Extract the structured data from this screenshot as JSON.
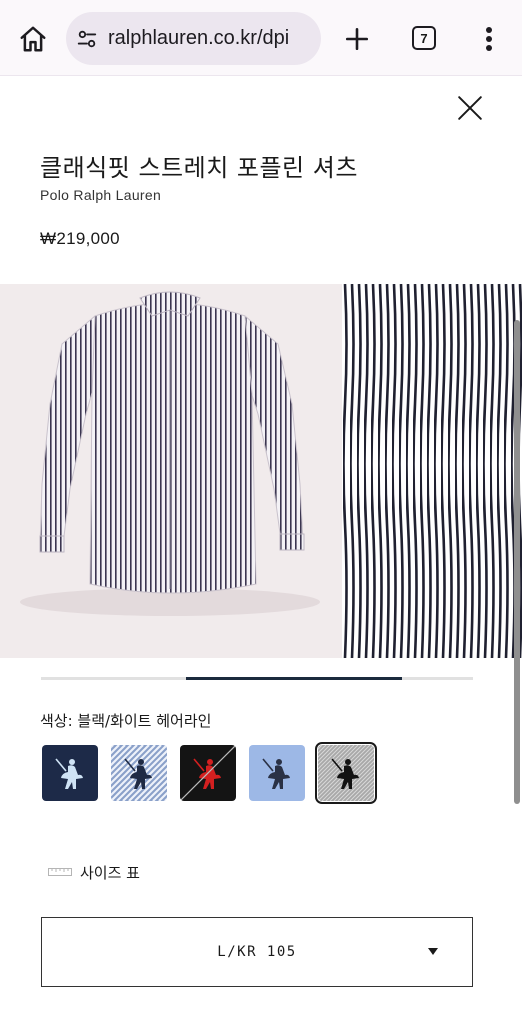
{
  "browser": {
    "url": "ralphlauren.co.kr/dpi",
    "tab_count": "7"
  },
  "product": {
    "title": "클래식핏 스트레치 포플린 셔츠",
    "brand": "Polo Ralph Lauren",
    "price": "₩219,000",
    "color_label": "색상: 블랙/화이트 헤어라인",
    "size_chart_label": "사이즈 표",
    "selected_size": "L/KR 105",
    "gallery_progress": {
      "start": 0.335,
      "end": 0.835
    }
  },
  "swatches": [
    {
      "name": "navy",
      "bg": "#1d2a48",
      "logo": "#cfe3f5",
      "selected": false,
      "unavailable": false
    },
    {
      "name": "blue-white-stripe",
      "bg": "#8aa0c9",
      "logo": "#1f2a44",
      "selected": false,
      "unavailable": false
    },
    {
      "name": "black",
      "bg": "#141414",
      "logo": "#d32020",
      "selected": false,
      "unavailable": true
    },
    {
      "name": "light-blue",
      "bg": "#9db8e6",
      "logo": "#2a3145",
      "selected": false,
      "unavailable": false
    },
    {
      "name": "black-white-hairline",
      "bg": "#a8a8a8",
      "logo": "#111111",
      "selected": true,
      "unavailable": false
    }
  ],
  "colors": {
    "accent": "#1b2a3d",
    "track": "#e1e1e1",
    "browser_bar": "#fbf8fb",
    "url_pill": "#ece6ef"
  },
  "icons": {
    "home": "home-icon",
    "site_settings": "tune-icon",
    "new_tab": "plus-icon",
    "tabs": "tab-switcher-icon",
    "menu": "more-vert-icon",
    "close": "close-icon",
    "ruler": "ruler-icon",
    "dropdown": "caret-down-icon"
  }
}
